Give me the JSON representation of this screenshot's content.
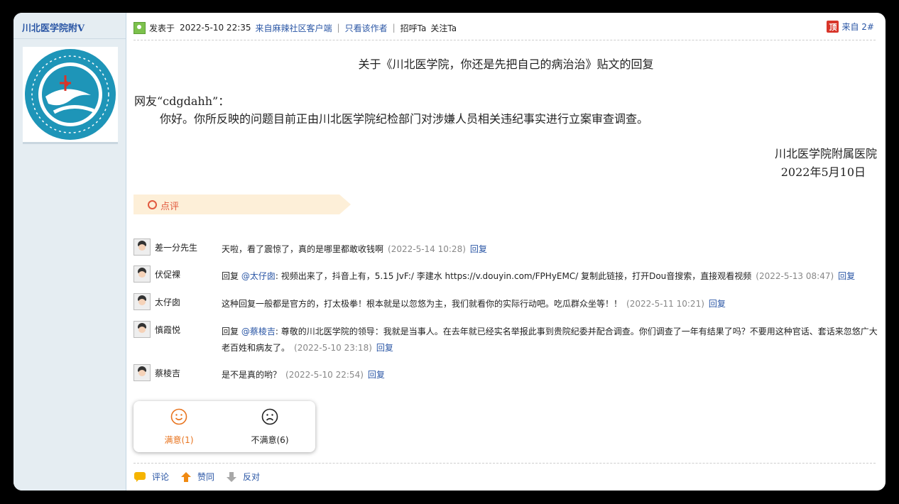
{
  "author": {
    "name": "川北医学院附",
    "verified_mark": "V"
  },
  "post": {
    "posted_prefix": "发表于",
    "posted_time": "2022-5-10 22:35",
    "source": "来自麻辣社区客户端",
    "only_author": "只看该作者",
    "greet": "招呼Ta",
    "follow": "关注Ta",
    "top_badge": "顶",
    "floor": "来自 2#"
  },
  "content": {
    "title": "关于《川北医学院，你还是先把自己的病治治》贴文的回复",
    "greeting": "网友“cdgdahh”：",
    "body": "你好。你所反映的问题目前正由川北医学院纪检部门对涉嫌人员相关违纪事实进行立案审查调查。",
    "signature_org": "川北医学院附属医院",
    "signature_date": "2022年5月10日"
  },
  "review": {
    "label": "点评"
  },
  "comments": [
    {
      "name": "差一分先生",
      "prefix": "",
      "mention": "",
      "text": "天啦，看了震惊了，真的是哪里都敢收钱啊",
      "time": "(2022-5-14 10:28)",
      "reply": "回复"
    },
    {
      "name": "伏促裸",
      "prefix": "回复 ",
      "mention": "@太仔囱",
      "text": ":  视频出来了，抖音上有，5.15 JvF:/ 李建水  https://v.douyin.com/FPHyEMC/ 复制此链接，打开Dou音搜索，直接观看视频",
      "time": "(2022-5-13 08:47)",
      "reply": "回复"
    },
    {
      "name": "太仔囱",
      "prefix": "",
      "mention": "",
      "text": "这种回复一般都是官方的，打太极拳！根本就是以忽悠为主，我们就看你的实际行动吧。吃瓜群众坐等！！",
      "time": "(2022-5-11 10:21)",
      "reply": "回复"
    },
    {
      "name": "慎霞悦",
      "prefix": "回复 ",
      "mention": "@蔡棱吉",
      "text": ":  尊敬的川北医学院的领导：我就是当事人。在去年就已经实名举报此事到贵院纪委并配合调查。你们调查了一年有结果了吗？不要用这种官话、套话来忽悠广大老百姓和病友了。",
      "time": "(2022-5-10 23:18)",
      "reply": "回复"
    },
    {
      "name": "蔡棱吉",
      "prefix": "",
      "mention": "",
      "text": "是不是真的哟？",
      "time": "(2022-5-10 22:54)",
      "reply": "回复"
    }
  ],
  "rating": {
    "satisfied": "满意(1)",
    "dissatisfied": "不满意(6)"
  },
  "actions": {
    "comment": "评论",
    "agree": "赞同",
    "oppose": "反对"
  },
  "colors": {
    "link": "#2a56a5",
    "accent_orange": "#e8741f",
    "review_red": "#e15a3f",
    "sidebar_bg": "#e5edf2"
  }
}
